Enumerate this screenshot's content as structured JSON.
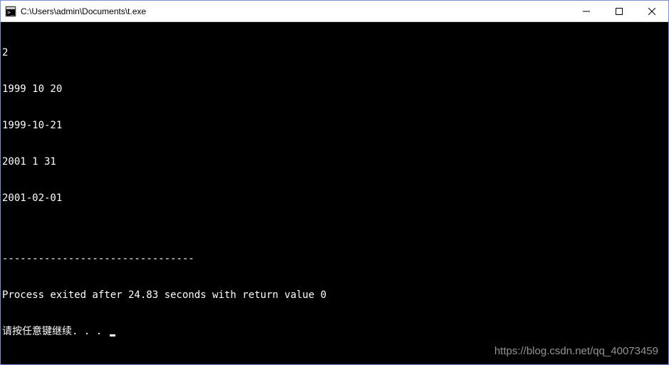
{
  "window": {
    "title": "C:\\Users\\admin\\Documents\\t.exe"
  },
  "terminal": {
    "lines": [
      "2",
      "1999 10 20",
      "1999-10-21",
      "2001 1 31",
      "2001-02-01",
      "",
      "--------------------------------",
      "Process exited after 24.83 seconds with return value 0"
    ],
    "prompt_prefix": "请按任意键继续. . . "
  },
  "watermark": "https://blog.csdn.net/qq_40073459"
}
